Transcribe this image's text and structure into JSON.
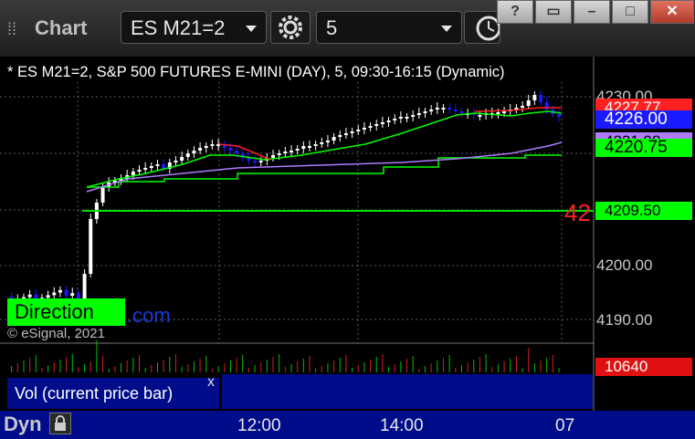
{
  "app": {
    "title": "Chart"
  },
  "toolbar": {
    "symbol": "ES M21=2",
    "interval": "5"
  },
  "window_buttons": [
    "?",
    "▭",
    "–",
    "□",
    "✕"
  ],
  "chart": {
    "header": "* ES M21=2, S&P 500 FUTURES E-MINI (DAY), 5, 09:30-16:15 (Dynamic)",
    "price_axis": [
      "4230.00",
      "4200.00",
      "4190.00"
    ],
    "price_tags": {
      "red": "4227.77",
      "last": "4226.00",
      "lavender": "4221.98",
      "green": "4220.75",
      "level": "4209.50",
      "volume": "10640"
    },
    "big_red_text": "42",
    "direction_label": "Direction",
    "dotcom_text": ".com",
    "copyright": "© eSignal, 2021",
    "volume_study_label": "Vol (current price bar)",
    "volume_close": "x",
    "time_axis": [
      "12:00",
      "14:00",
      "07"
    ],
    "mode": "Dyn"
  },
  "colors": {
    "bg": "#000000",
    "up_candle": "#ffffff",
    "down_candle": "#1a1aff",
    "green_line": "#00ff00",
    "red_line": "#ff2020",
    "lavender_line": "#b07cff",
    "panel_blue": "#000c8a"
  },
  "icons": [
    "grip-icon",
    "gear-icon",
    "clock-icon",
    "lock-icon",
    "close-icon"
  ]
}
